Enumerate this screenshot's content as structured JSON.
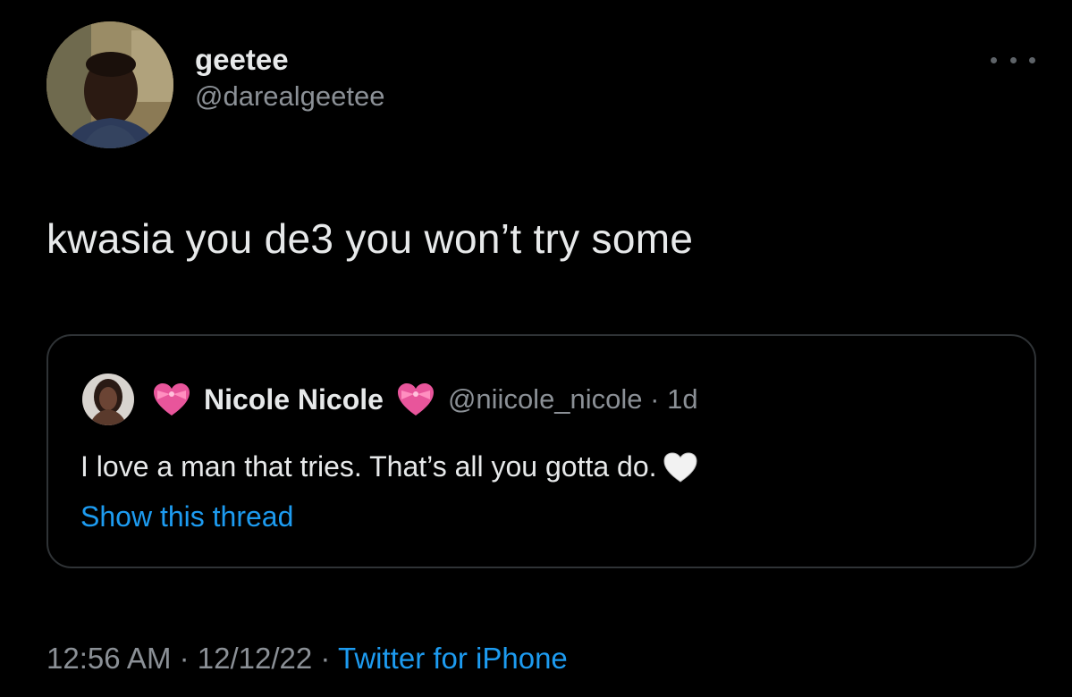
{
  "author": {
    "display_name": "geetee",
    "handle": "@darealgeetee"
  },
  "tweet": {
    "text": "kwasia you de3 you won’t try some"
  },
  "quoted_tweet": {
    "display_name": "Nicole Nicole",
    "handle_and_time": "@niicole_nicole · 1d",
    "text": "I love a man that tries. That’s all you gotta do.",
    "show_thread_label": "Show this thread",
    "emojis": [
      "heart-with-ribbon-icon",
      "white-heart-icon"
    ]
  },
  "meta": {
    "time": "12:56 AM",
    "separator": "·",
    "date": "12/12/22",
    "source": "Twitter for iPhone"
  },
  "colors": {
    "background": "#000000",
    "text": "#e7e9ea",
    "secondary_text": "#8b9096",
    "link": "#1d9bf0",
    "border": "#2f3336",
    "heart_pink": "#e8559b"
  },
  "icons": {
    "more": "more-horizontal-icon"
  }
}
